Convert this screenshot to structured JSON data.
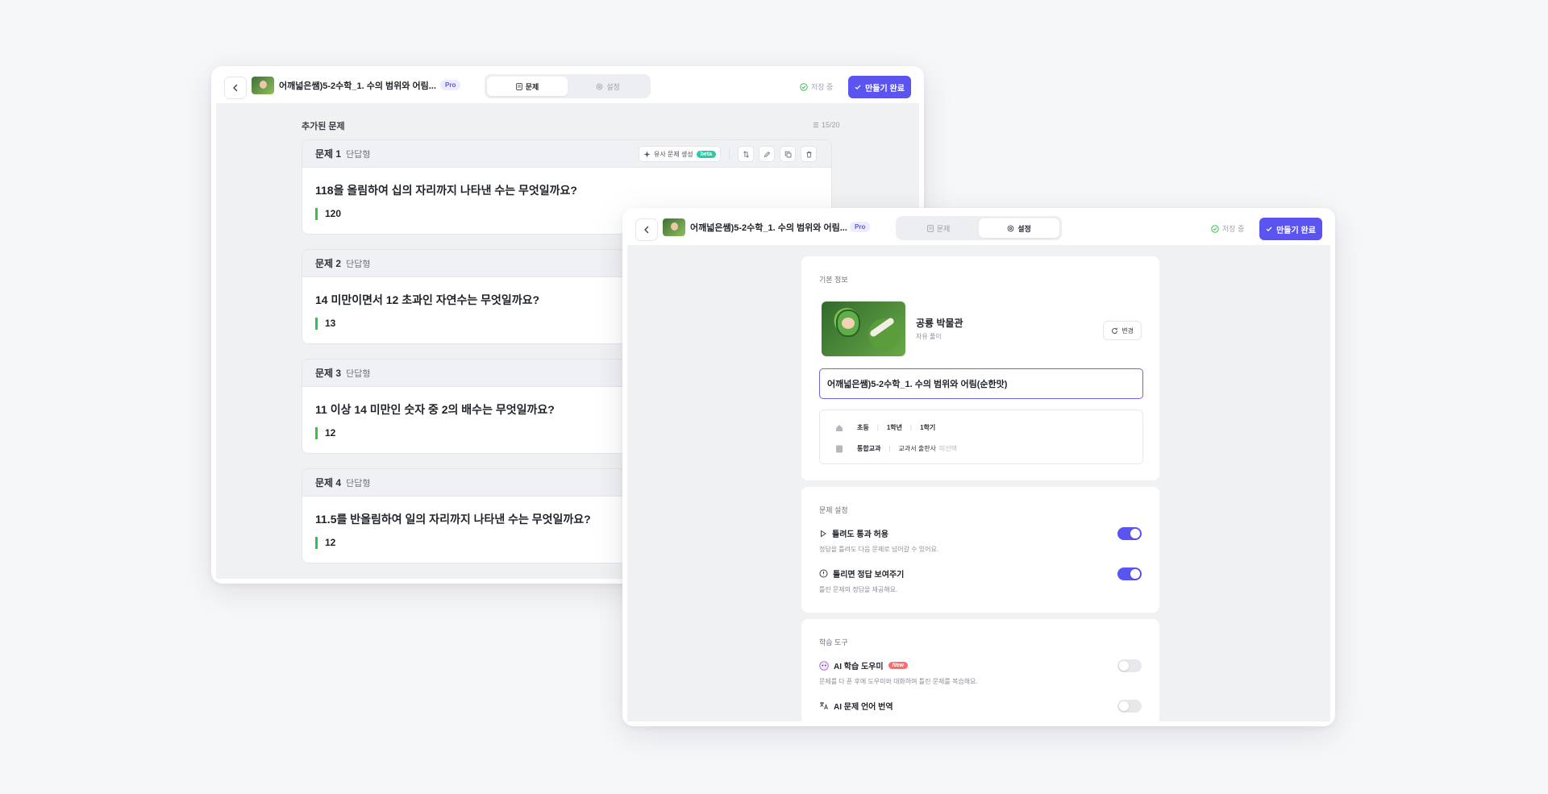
{
  "colors": {
    "accent": "#5b54f0",
    "answer_bar": "#34c24b",
    "beta": "#2cc9a2",
    "new": "#ff6b6b"
  },
  "window_a": {
    "doc_title": "어깨넓은쌤)5-2수학_1. 수의 범위와 어림...",
    "pro": "Pro",
    "tabs": [
      {
        "label": "문제",
        "icon": "document-icon",
        "active": true
      },
      {
        "label": "설정",
        "icon": "gear-icon",
        "active": false
      }
    ],
    "saving": "저장 중",
    "done": "만들기 완료",
    "section_title": "추가된 문제",
    "count": "15/20",
    "similar": "유사 문제 생성",
    "beta": "beta",
    "questions": [
      {
        "num": "문제 1",
        "type": "단답형",
        "text": "118을 올림하여 십의 자리까지 나타낸 수는 무엇일까요?",
        "answer": "120"
      },
      {
        "num": "문제 2",
        "type": "단답형",
        "text": "14 미만이면서 12 초과인 자연수는 무엇일까요?",
        "answer": "13"
      },
      {
        "num": "문제 3",
        "type": "단답형",
        "text": "11 이상 14 미만인 숫자 중 2의 배수는 무엇일까요?",
        "answer": "12"
      },
      {
        "num": "문제 4",
        "type": "단답형",
        "text": "11.5를 반올림하여 일의 자리까지 나타낸 수는 무엇일까요?",
        "answer": "12"
      }
    ]
  },
  "window_b": {
    "doc_title": "어깨넓은쌤)5-2수학_1. 수의 범위와 어림...",
    "pro": "Pro",
    "tabs": [
      {
        "label": "문제",
        "icon": "document-icon",
        "active": false
      },
      {
        "label": "설정",
        "icon": "gear-icon",
        "active": true
      }
    ],
    "saving": "저장 중",
    "done": "만들기 완료",
    "basic": {
      "label": "기본 정보",
      "theme_name": "공룡 박물관",
      "theme_sub": "자유 풀이",
      "change": "변경",
      "title_value": "어깨넓은쌤)5-2수학_1. 수의 범위와 어림(순한맛)",
      "level": "초등",
      "grade": "1학년",
      "semester": "1학기",
      "subject": "통합교과",
      "publisher_label": "교과서 출판사",
      "publisher_value": "미선택"
    },
    "problem_settings": {
      "label": "문제 설정",
      "items": [
        {
          "title": "틀려도 통과 허용",
          "desc": "정답을 틀려도 다음 문제로 넘어갈 수 있어요.",
          "icon": "play-icon",
          "on": true
        },
        {
          "title": "틀리면 정답 보여주기",
          "desc": "틀린 문제의 정답을 제공해요.",
          "icon": "hint-icon",
          "on": true
        }
      ]
    },
    "learning_tools": {
      "label": "학습 도구",
      "items": [
        {
          "title": "AI 학습 도우미",
          "badge": "New",
          "desc": "문제를 다 푼 후에 도우미와 대화하며 틀린 문제를 복습해요.",
          "icon": "ai-helper-icon",
          "on": false
        },
        {
          "title": "AI 문제 언어 번역",
          "desc": "",
          "icon": "translate-icon",
          "on": false
        }
      ]
    }
  }
}
